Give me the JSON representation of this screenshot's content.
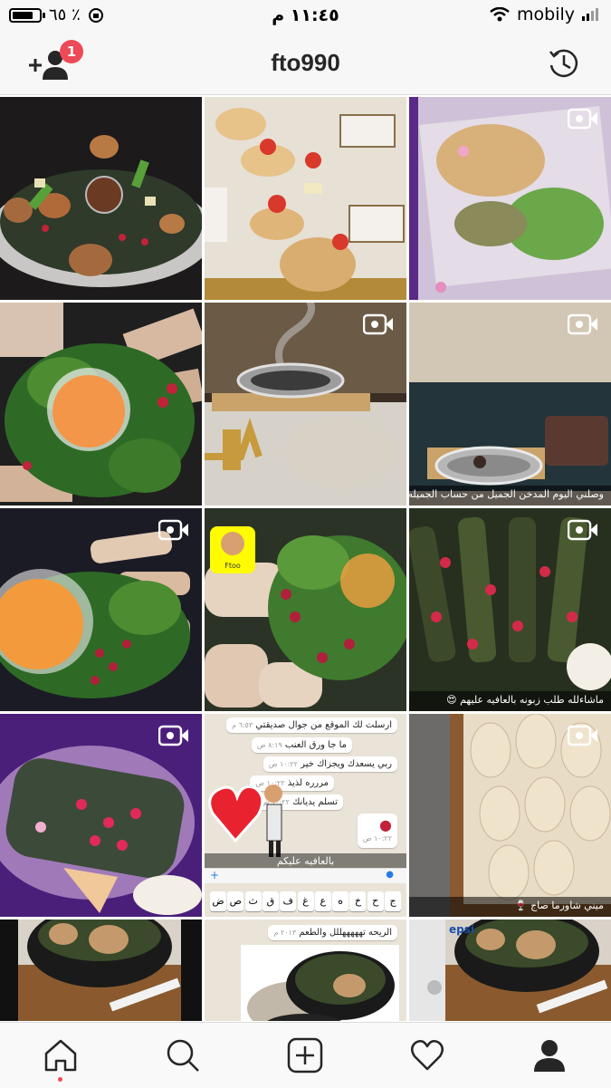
{
  "status_bar": {
    "battery": "٦٥ ٪",
    "time": "١١:٤٥ م",
    "carrier": "mobily"
  },
  "header": {
    "username": "fto990",
    "notification_count": "1",
    "left_icon": "add-user-icon",
    "right_icon": "history-icon"
  },
  "grid": {
    "captions": {
      "r2c3": "وصلني اليوم المدخن الجميل من حساب الجميله",
      "r3c3": "ماشاءلله طلب زبونه بالعافيه عليهم 😍",
      "r4c2": "بالعافيه عليكم",
      "r4c3": "ميني شاورما صاج 🍷"
    },
    "chat": {
      "bubbles": [
        {
          "text": "ارسلت لك الموقع من جوال صديقتي",
          "time": "٦:٥٣ م"
        },
        {
          "text": "ما جا ورق العنب",
          "time": "٨:١٩ ص"
        },
        {
          "text": "ربي يسعدك ويجزاك خير",
          "time": "١٠:٢٢ ص"
        },
        {
          "text": "مررره لذيذ",
          "time": "١٠:٢٢ ص"
        },
        {
          "text": "تسلم يديانك",
          "time": "١٠:٢٢ ص"
        }
      ],
      "rose_time": "١٠:٢٢ ص",
      "keyboard_row": [
        "ج",
        "ح",
        "خ",
        "ه",
        "ع",
        "غ",
        "ف",
        "ق",
        "ث",
        "ص",
        "ض"
      ],
      "row5_chat": "الريحه تهههههللل والطعم",
      "row5_time": "٢٠١٣ م"
    },
    "snapchat_label": "Ftoo",
    "pepsi_label": "epsi",
    "video_icon": "video-camera-icon"
  },
  "tab_bar": {
    "items": [
      "home-icon",
      "search-icon",
      "add-post-icon",
      "heart-icon",
      "profile-icon"
    ],
    "active": "home-icon"
  },
  "colors": {
    "badge": "#ed4956",
    "background": "#ffffff",
    "bar": "#f7f7f7"
  }
}
